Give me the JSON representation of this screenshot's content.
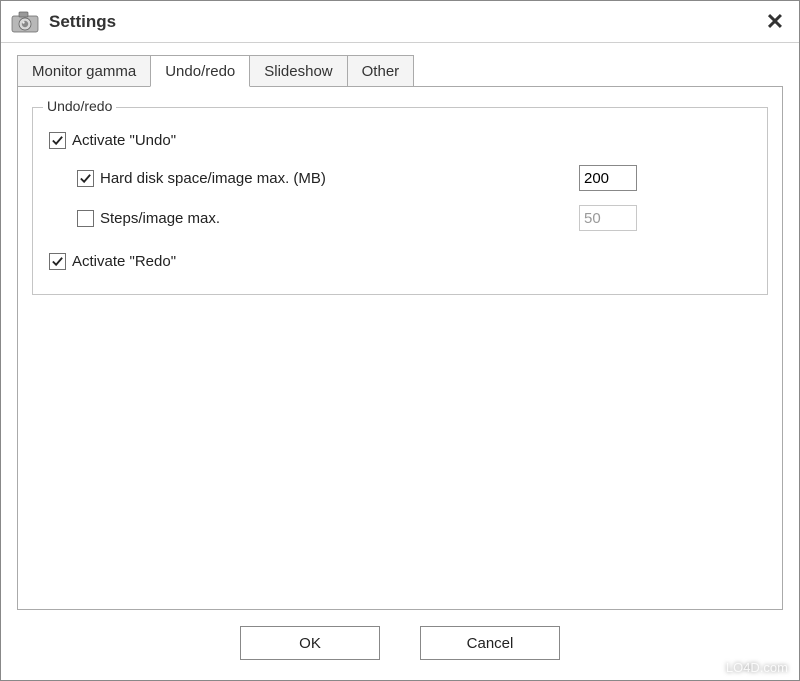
{
  "window": {
    "title": "Settings",
    "close_label": "✕"
  },
  "tabs": {
    "items": [
      {
        "label": "Monitor gamma"
      },
      {
        "label": "Undo/redo"
      },
      {
        "label": "Slideshow"
      },
      {
        "label": "Other"
      }
    ],
    "active_index": 1
  },
  "panel": {
    "group_title": "Undo/redo",
    "activate_undo": {
      "label": "Activate \"Undo\"",
      "checked": true
    },
    "hard_disk": {
      "label": "Hard disk space/image max. (MB)",
      "checked": true,
      "value": "200"
    },
    "steps": {
      "label": "Steps/image max.",
      "checked": false,
      "value": "50"
    },
    "activate_redo": {
      "label": "Activate \"Redo\"",
      "checked": true
    }
  },
  "buttons": {
    "ok": "OK",
    "cancel": "Cancel"
  },
  "watermark": "LO4D.com"
}
